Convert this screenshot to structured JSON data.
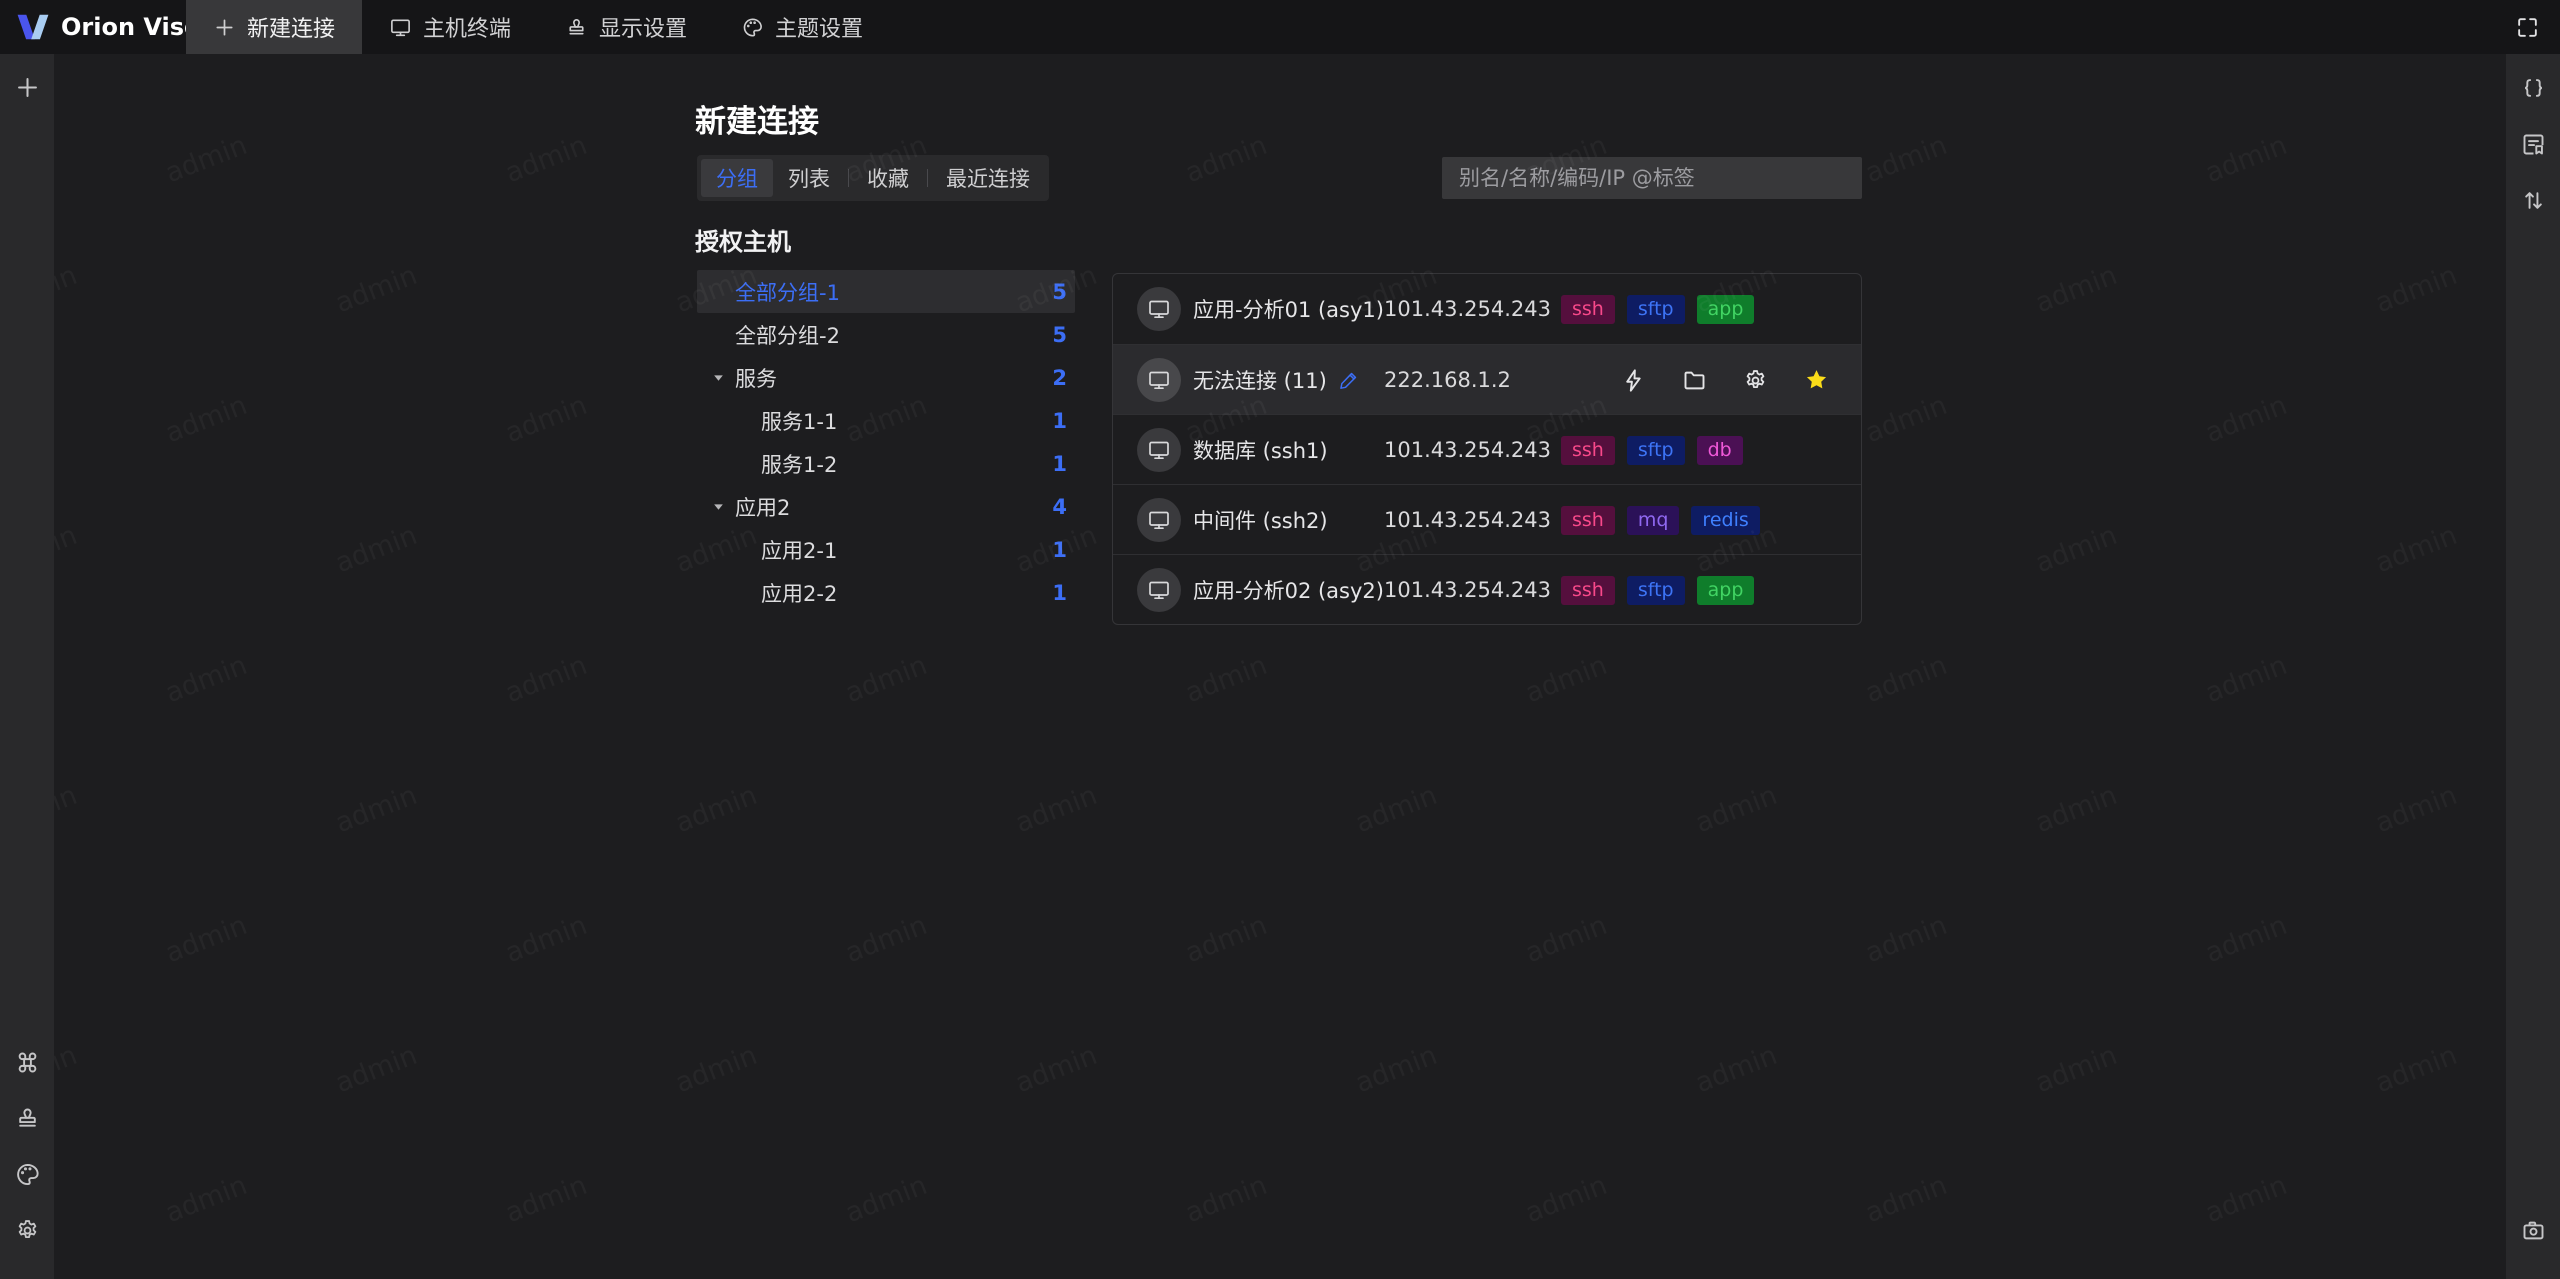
{
  "topbar": {
    "brand": "Orion Visor",
    "fullscreen_icon": "fullscreen",
    "tabs": [
      {
        "label": "新建连接",
        "icon": "plus",
        "active": true
      },
      {
        "label": "主机终端",
        "icon": "monitor",
        "active": false
      },
      {
        "label": "显示设置",
        "icon": "stamp",
        "active": false
      },
      {
        "label": "主题设置",
        "icon": "palette",
        "active": false
      }
    ]
  },
  "left_sidebar": {
    "top_icons": [
      {
        "icon": "plus"
      }
    ],
    "bottom_icons": [
      {
        "icon": "command"
      },
      {
        "icon": "stamp"
      },
      {
        "icon": "palette"
      },
      {
        "icon": "gear"
      }
    ]
  },
  "right_sidebar": {
    "top_icons": [
      {
        "icon": "braces"
      },
      {
        "icon": "doc-bookmark"
      },
      {
        "icon": "sort-vertical"
      }
    ],
    "bottom_icons": [
      {
        "icon": "camera"
      }
    ]
  },
  "page": {
    "title": "新建连接",
    "view_tabs": [
      {
        "label": "分组",
        "active": true,
        "divider_after": false
      },
      {
        "label": "列表",
        "active": false,
        "divider_after": true
      },
      {
        "label": "收藏",
        "active": false,
        "divider_after": true
      },
      {
        "label": "最近连接",
        "active": false,
        "divider_after": false
      }
    ],
    "search_placeholder": "别名/名称/编码/IP @标签",
    "section_title": "授权主机",
    "tree": [
      {
        "label": "全部分组-1",
        "count": "5",
        "level": 0,
        "expandable": false,
        "selected": true
      },
      {
        "label": "全部分组-2",
        "count": "5",
        "level": 0,
        "expandable": false,
        "selected": false
      },
      {
        "label": "服务",
        "count": "2",
        "level": 0,
        "expandable": true,
        "selected": false
      },
      {
        "label": "服务1-1",
        "count": "1",
        "level": 1,
        "expandable": false,
        "selected": false
      },
      {
        "label": "服务1-2",
        "count": "1",
        "level": 1,
        "expandable": false,
        "selected": false
      },
      {
        "label": "应用2",
        "count": "4",
        "level": 0,
        "expandable": true,
        "selected": false
      },
      {
        "label": "应用2-1",
        "count": "1",
        "level": 1,
        "expandable": false,
        "selected": false
      },
      {
        "label": "应用2-2",
        "count": "1",
        "level": 1,
        "expandable": false,
        "selected": false
      }
    ],
    "hosts": [
      {
        "name": "应用-分析01 (asy1)",
        "ip": "101.43.254.243",
        "editable": false,
        "hovered": false,
        "tags": [
          "ssh",
          "sftp",
          "app"
        ],
        "actions": []
      },
      {
        "name": "无法连接 (11)",
        "ip": "222.168.1.2",
        "editable": true,
        "hovered": true,
        "tags": [],
        "actions": [
          "lightning",
          "folder",
          "gear",
          "star"
        ]
      },
      {
        "name": "数据库 (ssh1)",
        "ip": "101.43.254.243",
        "editable": false,
        "hovered": false,
        "tags": [
          "ssh",
          "sftp",
          "db"
        ],
        "actions": []
      },
      {
        "name": "中间件 (ssh2)",
        "ip": "101.43.254.243",
        "editable": false,
        "hovered": false,
        "tags": [
          "ssh",
          "mq",
          "redis"
        ],
        "actions": []
      },
      {
        "name": "应用-分析02 (asy2)",
        "ip": "101.43.254.243",
        "editable": false,
        "hovered": false,
        "tags": [
          "ssh",
          "sftp",
          "app"
        ],
        "actions": []
      }
    ],
    "tag_styles": {
      "ssh": {
        "bg": "#550f3d",
        "fg": "#f8498a"
      },
      "sftp": {
        "bg": "#0e1c63",
        "fg": "#3d74f6"
      },
      "app": {
        "bg": "#0f7d2b",
        "fg": "#41d463"
      },
      "db": {
        "bg": "#4b1054",
        "fg": "#ef58d8"
      },
      "mq": {
        "bg": "#2b1158",
        "fg": "#8f68f0"
      },
      "redis": {
        "bg": "#0e1c63",
        "fg": "#3f80ff"
      }
    }
  },
  "watermark_text": "admin",
  "colors": {
    "accent": "#3c6ef5",
    "star": "#fadc19",
    "logo_left": "#4a55ee",
    "logo_right": "#a9cdf2"
  }
}
